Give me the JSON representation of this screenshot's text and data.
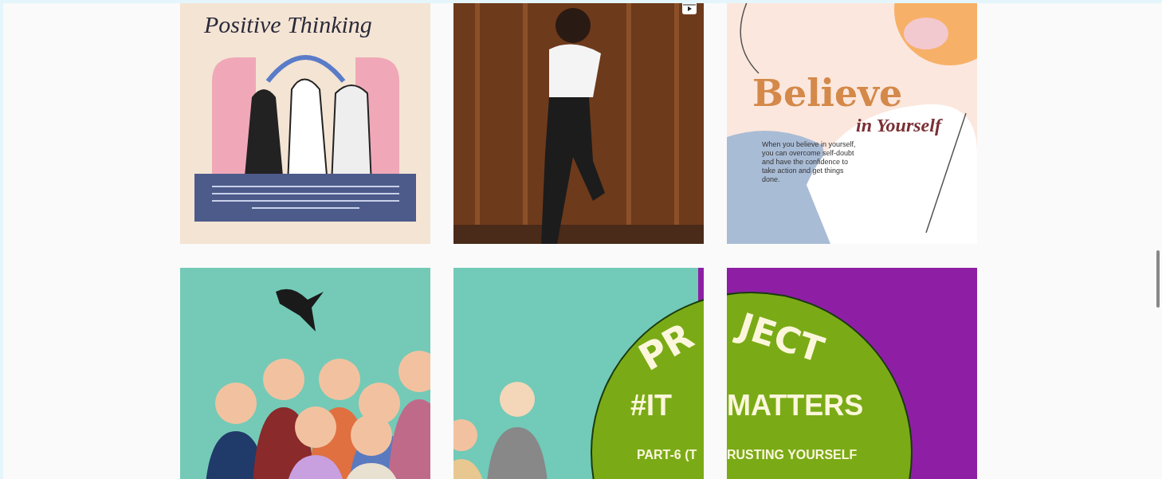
{
  "posts": [
    {
      "kind": "positive",
      "lines": [
        "Positive Thinking"
      ]
    },
    {
      "kind": "video"
    },
    {
      "kind": "believe",
      "lines": [
        "Believe",
        "in Yourself",
        "When you believe in yourself, you can overcome self-doubt and have the confidence to take action and get things done."
      ]
    },
    {
      "kind": "crowd"
    },
    {
      "kind": "project_left",
      "lines": [
        "PR",
        "#IT",
        "PART-6 (T"
      ]
    },
    {
      "kind": "project_right",
      "lines": [
        "JECT",
        "MATTERS",
        "RUSTING YOURSELF"
      ]
    }
  ]
}
